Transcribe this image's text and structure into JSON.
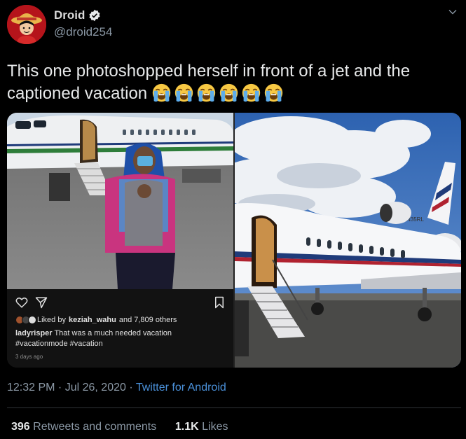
{
  "author": {
    "name": "Droid",
    "handle": "@droid254"
  },
  "tweet": {
    "text": "This one photoshopped herself in front of a jet and the captioned vacation",
    "emoji_count": 6,
    "emoji": "loudly-crying-face"
  },
  "instagram": {
    "liked_by_prefix": "Liked by ",
    "liked_by_user": "keziah_wahu",
    "liked_by_suffix": " and 7,809 others",
    "caption_user": "ladyrisper",
    "caption_text": " That was a much needed vacation",
    "hashtags": "#vacationmode #vacation",
    "time_ago": "3 days ago"
  },
  "jet": {
    "tail_registration": "N35RL"
  },
  "meta": {
    "time": "12:32 PM",
    "separator1": " · ",
    "date": "Jul 26, 2020",
    "separator2": " · ",
    "source": "Twitter for Android"
  },
  "stats": {
    "retweets_count": "396",
    "retweets_label": " Retweets and comments",
    "likes_count": "1.1K",
    "likes_label": " Likes"
  },
  "colors": {
    "background": "#000000",
    "link": "#4a90d9",
    "secondary_text": "#8b98a5"
  }
}
